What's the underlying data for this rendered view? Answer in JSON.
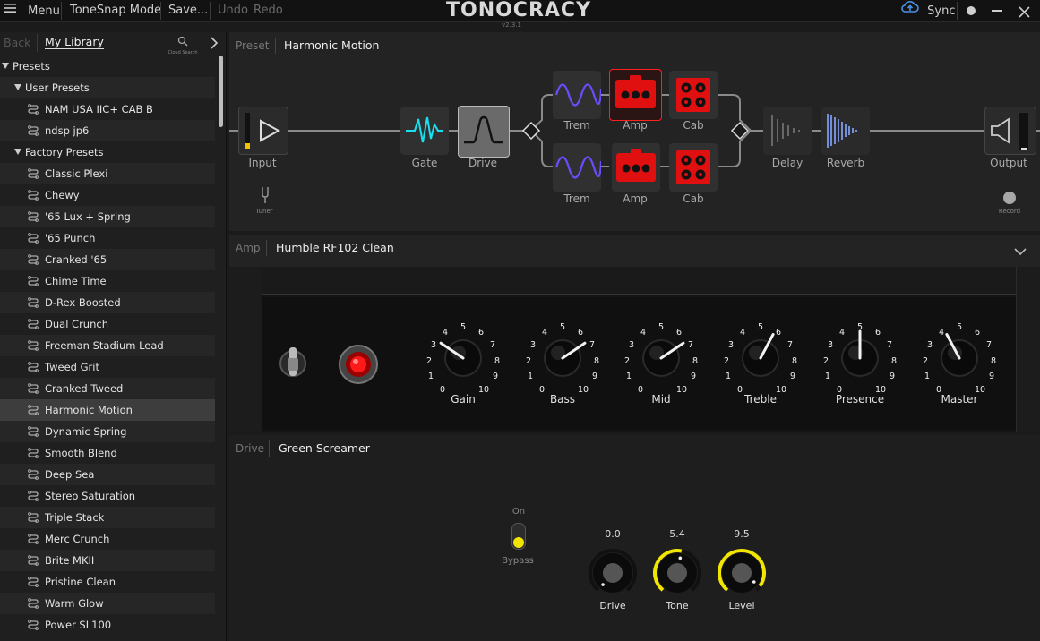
{
  "topbar": {
    "menu": "Menu",
    "mode": "ToneSnap Mode",
    "save": "Save...",
    "undo": "Undo",
    "redo": "Redo",
    "logo": "TONOCRACY",
    "version": "v2.3.1",
    "sync": "Sync"
  },
  "sidebar": {
    "back": "Back",
    "tab": "My Library",
    "cloud_search": "Cloud Search",
    "presets_header": "Presets",
    "user_presets_header": "User Presets",
    "user_presets": [
      "NAM USA IIC+ CAB B",
      "ndsp jp6"
    ],
    "factory_presets_header": "Factory Presets",
    "factory_presets": [
      "Classic Plexi",
      "Chewy",
      "'65 Lux + Spring",
      "'65 Punch",
      "Cranked '65",
      "Chime Time",
      "D-Rex Boosted",
      "Dual Crunch",
      "Freeman Stadium Lead",
      "Tweed Grit",
      "Cranked Tweed",
      "Harmonic Motion",
      "Dynamic Spring",
      "Smooth Blend",
      "Deep Sea",
      "Stereo Saturation",
      "Triple Stack",
      "Merc Crunch",
      "Brite MKII",
      "Pristine Clean",
      "Warm Glow",
      "Power SL100"
    ],
    "selected": "Harmonic Motion"
  },
  "preset": {
    "label": "Preset",
    "name": "Harmonic Motion",
    "chain": {
      "input": "Input",
      "gate": "Gate",
      "drive": "Drive",
      "trem": "Trem",
      "amp": "Amp",
      "cab": "Cab",
      "delay": "Delay",
      "reverb": "Reverb",
      "output": "Output",
      "tuner": "Tuner",
      "record": "Record"
    }
  },
  "amp": {
    "label": "Amp",
    "name": "Humble RF102 Clean",
    "knobs": [
      {
        "label": "Gain",
        "value": 3
      },
      {
        "label": "Bass",
        "value": 7
      },
      {
        "label": "Mid",
        "value": 7
      },
      {
        "label": "Treble",
        "value": 6
      },
      {
        "label": "Presence",
        "value": 5
      },
      {
        "label": "Master",
        "value": 4
      }
    ],
    "scale": [
      "0",
      "1",
      "2",
      "3",
      "4",
      "5",
      "6",
      "7",
      "8",
      "9",
      "10"
    ]
  },
  "drive_panel": {
    "label": "Drive",
    "name": "Green Screamer",
    "on": "On",
    "bypass": "Bypass",
    "knobs": [
      {
        "label": "Drive",
        "value": "0.0"
      },
      {
        "label": "Tone",
        "value": "5.4"
      },
      {
        "label": "Level",
        "value": "9.5"
      }
    ]
  },
  "colors": {
    "accent_red": "#e01010",
    "accent_yellow": "#f2e600",
    "accent_cyan": "#17e0f0",
    "accent_purple": "#6b4cff"
  }
}
